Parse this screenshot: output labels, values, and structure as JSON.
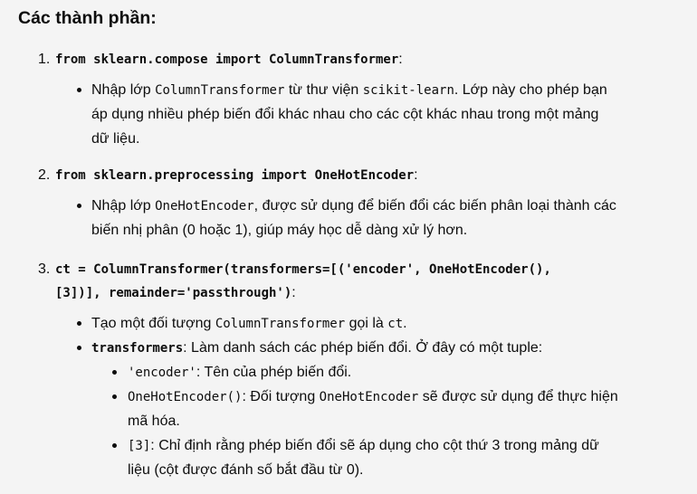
{
  "heading": "Các thành phần:",
  "items": [
    {
      "number": "1.",
      "code": "from sklearn.compose import ColumnTransformer",
      "suffix": ":",
      "bullet_pre": "Nhập lớp ",
      "bullet_code": "ColumnTransformer",
      "bullet_mid": " từ thư viện ",
      "bullet_code2": "scikit-learn",
      "bullet_post1": ". Lớp này cho phép bạn",
      "bullet_line2": "áp dụng nhiều phép biến đổi khác nhau cho các cột khác nhau trong một mảng",
      "bullet_line3": "dữ liệu."
    },
    {
      "number": "2.",
      "code": "from sklearn.preprocessing import OneHotEncoder",
      "suffix": ":",
      "bullet_pre": "Nhập lớp ",
      "bullet_code": "OneHotEncoder",
      "bullet_post1": ", được sử dụng để biến đổi các biến phân loại thành các",
      "bullet_line2": "biến nhị phân (0 hoặc 1), giúp máy học dễ dàng xử lý hơn."
    },
    {
      "number": "3.",
      "code_line1": "ct = ColumnTransformer(transformers=[('encoder', OneHotEncoder(),",
      "code_line2": "[3])], remainder='passthrough')",
      "suffix": ":",
      "b1_pre": "Tạo một đối tượng ",
      "b1_code": "ColumnTransformer",
      "b1_mid": " gọi là ",
      "b1_code2": "ct",
      "b1_post": ".",
      "b2_code": "transformers",
      "b2_post": ": Làm danh sách các phép biến đổi. Ở đây có một tuple:",
      "sub": [
        {
          "code": "'encoder'",
          "text": ": Tên của phép biến đổi."
        },
        {
          "code": "OneHotEncoder()",
          "text_pre": ": Đối tượng ",
          "code2": "OneHotEncoder",
          "text_post": " sẽ được sử dụng để thực hiện",
          "line2": "mã hóa."
        },
        {
          "code": "[3]",
          "text": ": Chỉ định rằng phép biến đổi sẽ áp dụng cho cột thứ 3 trong mảng dữ",
          "line2": "liệu (cột được đánh số bắt đầu từ 0)."
        }
      ]
    }
  ]
}
